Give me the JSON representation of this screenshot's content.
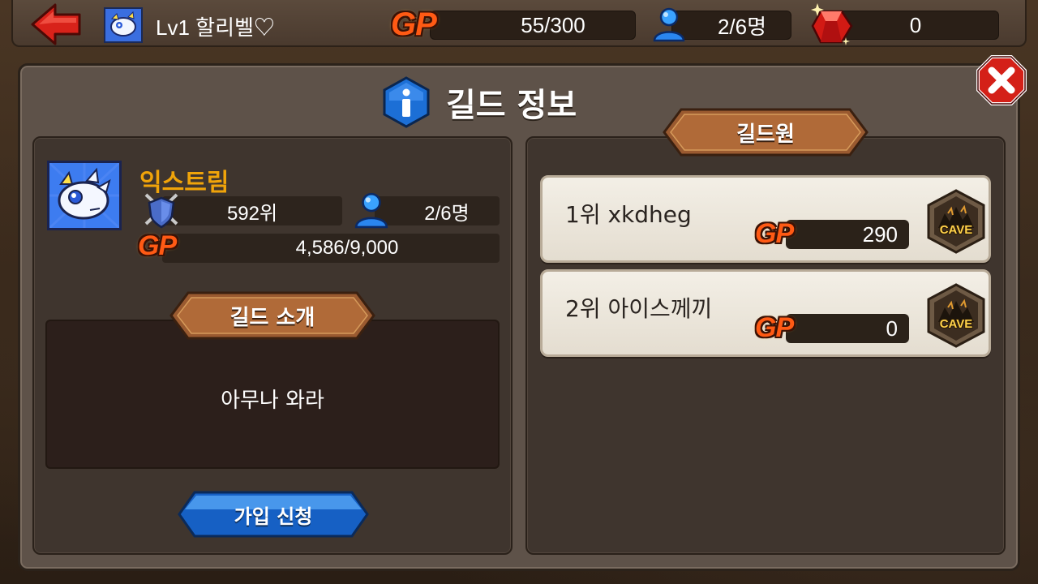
{
  "topbar": {
    "player_name": "Lv1 할리벨♡",
    "gp_label": "GP",
    "gp_value": "55/300",
    "members_value": "2/6명",
    "gems_value": "0"
  },
  "panel": {
    "title": "길드 정보"
  },
  "guild": {
    "name": "익스트림",
    "rank": "592위",
    "members": "2/6명",
    "gp_label": "GP",
    "gp_value": "4,586/9,000",
    "intro_tab": "길드 소개",
    "intro_text": "아무나 와라",
    "join_label": "가입 신청"
  },
  "members_panel": {
    "tab_label": "길드원",
    "members": [
      {
        "name": "1위 xkdheg",
        "gp_label": "GP",
        "gp": "290",
        "badge": "CAVE"
      },
      {
        "name": "2위 아이스께끼",
        "gp_label": "GP",
        "gp": "0",
        "badge": "CAVE"
      }
    ]
  }
}
